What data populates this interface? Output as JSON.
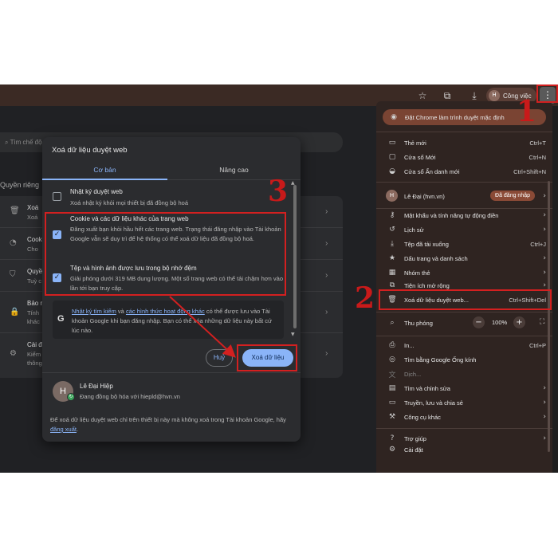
{
  "toolbar": {
    "profile_name": "Công việc",
    "profile_initial": "H",
    "star_icon": "star-icon",
    "extensions_icon": "extensions-icon",
    "download_icon": "download-icon",
    "menu_icon": "kebab-menu-icon"
  },
  "settings": {
    "search_placeholder": "Tìm chế độ cài đặt",
    "section_heading": "Quyền riêng",
    "rows": [
      {
        "title": "Xoá",
        "desc": "Xoá",
        "icon": "trash-icon"
      },
      {
        "title": "Cook",
        "desc": "Cho",
        "icon": "cookie-icon"
      },
      {
        "title": "Quyề",
        "desc": "Tuỳ c",
        "icon": "shield-search-icon"
      },
      {
        "title": "Bảo m",
        "desc": "Tính",
        "desc2": "khác",
        "icon": "lock-icon"
      },
      {
        "title": "Cài đ",
        "desc": "Kiểm",
        "desc2": "thông",
        "icon": "sliders-icon"
      }
    ]
  },
  "menu": {
    "default_banner": "Đặt Chrome làm trình duyệt mặc định",
    "items_group1": [
      {
        "label": "Thẻ mới",
        "shortcut": "Ctrl+T",
        "icon": "new-tab-icon"
      },
      {
        "label": "Cửa sổ Mới",
        "shortcut": "Ctrl+N",
        "icon": "new-window-icon"
      },
      {
        "label": "Cửa sổ Ẩn danh mới",
        "shortcut": "Ctrl+Shift+N",
        "icon": "incognito-icon"
      }
    ],
    "profile": {
      "name": "Lê Đại (hvn.vn)",
      "initial": "H",
      "badge": "Đã đăng nhập"
    },
    "items_group2": [
      {
        "label": "Mật khẩu và tính năng tự động điền",
        "icon": "key-icon",
        "arrow": true
      },
      {
        "label": "Lịch sử",
        "icon": "history-icon",
        "arrow": true
      },
      {
        "label": "Tệp đã tải xuống",
        "shortcut": "Ctrl+J",
        "icon": "download-icon"
      },
      {
        "label": "Dấu trang và danh sách",
        "icon": "bookmark-star-icon",
        "arrow": true
      },
      {
        "label": "Nhóm thẻ",
        "icon": "tab-groups-icon",
        "arrow": true
      },
      {
        "label": "Tiện ích mở rộng",
        "icon": "extensions-icon",
        "arrow": true
      },
      {
        "label": "Xoá dữ liệu duyệt web...",
        "shortcut": "Ctrl+Shift+Del",
        "icon": "trash-icon"
      }
    ],
    "zoom": {
      "label": "Thu phóng",
      "value": "100%",
      "minus": "−",
      "plus": "+"
    },
    "items_group3": [
      {
        "label": "In...",
        "shortcut": "Ctrl+P",
        "icon": "print-icon"
      },
      {
        "label": "Tìm bằng Google Ống kính",
        "icon": "lens-icon"
      },
      {
        "label": "Dịch...",
        "icon": "translate-icon",
        "disabled": true
      },
      {
        "label": "Tìm và chỉnh sửa",
        "icon": "find-icon",
        "arrow": true
      },
      {
        "label": "Truyền, lưu và chia sẻ",
        "icon": "cast-icon",
        "arrow": true
      },
      {
        "label": "Công cụ khác",
        "icon": "toolbox-icon",
        "arrow": true
      }
    ],
    "items_group4": [
      {
        "label": "Trợ giúp",
        "icon": "help-icon",
        "arrow": true
      },
      {
        "label": "Cài đặt",
        "icon": "gear-icon"
      }
    ]
  },
  "dialog": {
    "title": "Xoá dữ liệu duyệt web",
    "tabs": [
      "Cơ bản",
      "Nâng cao"
    ],
    "options": [
      {
        "title": "Nhật ký duyệt web",
        "desc": "Xoá nhật ký khỏi mọi thiết bị đã đồng bộ hoá",
        "checked": false
      },
      {
        "title": "Cookie và các dữ liệu khác của trang web",
        "desc": "Đăng xuất bạn khỏi hầu hết các trang web. Trạng thái đăng nhập vào Tài khoản Google vẫn sẽ duy trì để hệ thống có thể xoá dữ liệu đã đồng bộ hoá.",
        "checked": true
      },
      {
        "title": "Tệp và hình ảnh được lưu trong bộ nhớ đệm",
        "desc": "Giải phóng dưới 319 MB dung lượng. Một số trang web có thể tải chậm hơn vào lần tới bạn truy cập.",
        "checked": true
      }
    ],
    "info": {
      "link1": "Nhật ký tìm kiếm",
      "mid": " và ",
      "link2": "các hình thức hoạt động khác",
      "rest": " có thể được lưu vào Tài khoản Google khi bạn đăng nhập. Bạn có thể xóa những dữ liệu này bất cứ lúc nào."
    },
    "cancel_label": "Huỷ",
    "clear_label": "Xoá dữ liệu",
    "account": {
      "initial": "H",
      "name": "Lê Đại Hiệp",
      "status": "Đang đồng bộ hóa với hiepld@hvn.vn"
    },
    "footer": {
      "text": "Để xoá dữ liệu duyệt web chỉ trên thiết bị này mà không xoá trong Tài khoản Google, hãy ",
      "link": "đăng xuất",
      "end": "."
    }
  },
  "annotations": {
    "step1": "1",
    "step2": "2",
    "step3": "3",
    "color": "#d32020"
  }
}
